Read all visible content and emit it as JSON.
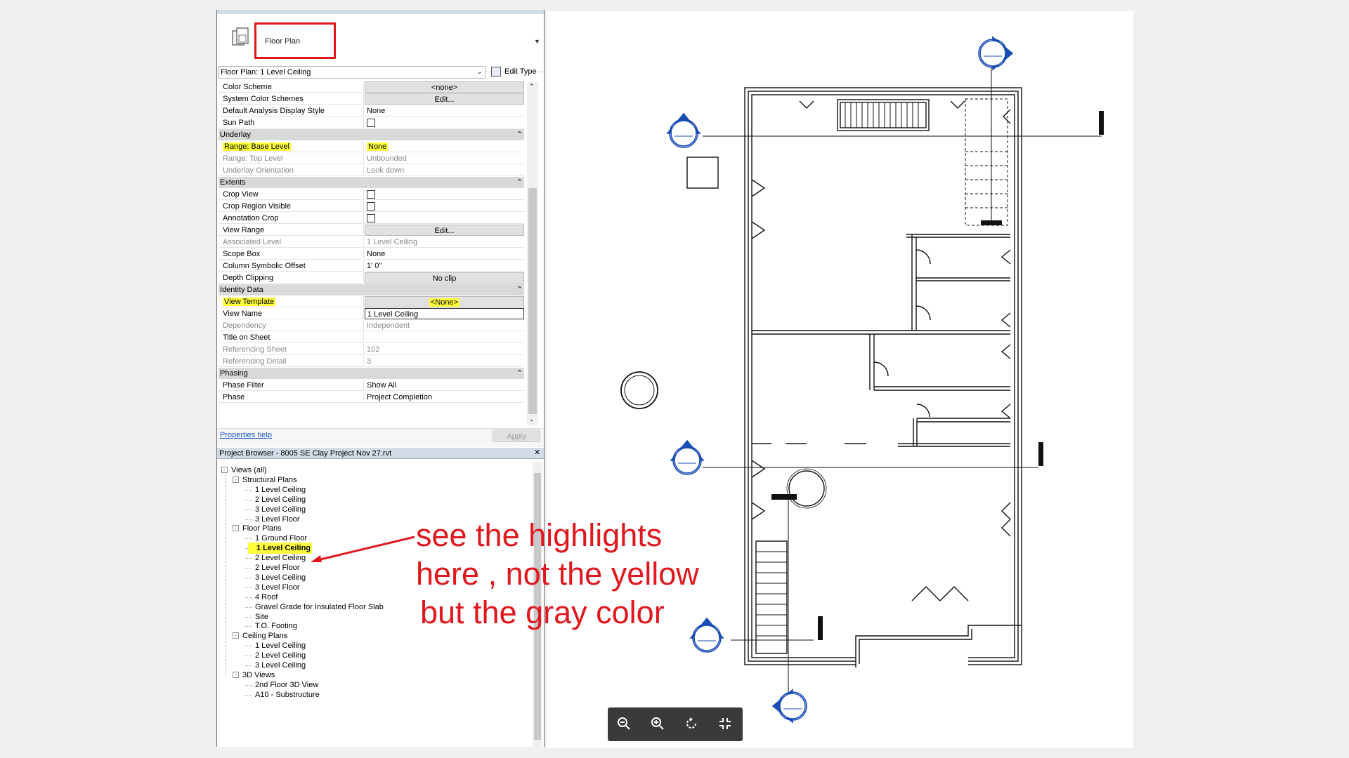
{
  "properties": {
    "type_name": "Floor Plan",
    "view_selector": "Floor Plan: 1 Level Ceiling",
    "edit_type_label": "Edit Type",
    "rows": [
      {
        "kind": "prop",
        "label": "Color Scheme",
        "value": "<none>",
        "style": "btn"
      },
      {
        "kind": "prop",
        "label": "System Color Schemes",
        "value": "Edit...",
        "style": "btn"
      },
      {
        "kind": "prop",
        "label": "Default Analysis Display Style",
        "value": "None"
      },
      {
        "kind": "prop",
        "label": "Sun Path",
        "value": "",
        "style": "check"
      },
      {
        "kind": "group",
        "label": "Underlay"
      },
      {
        "kind": "prop",
        "label": "Range: Base Level",
        "value": "None",
        "highlight": true
      },
      {
        "kind": "prop",
        "label": "Range: Top Level",
        "value": "Unbounded",
        "disabled": true
      },
      {
        "kind": "prop",
        "label": "Underlay Orientation",
        "value": "Look down",
        "disabled": true
      },
      {
        "kind": "group",
        "label": "Extents"
      },
      {
        "kind": "prop",
        "label": "Crop View",
        "value": "",
        "style": "check"
      },
      {
        "kind": "prop",
        "label": "Crop Region Visible",
        "value": "",
        "style": "check"
      },
      {
        "kind": "prop",
        "label": "Annotation Crop",
        "value": "",
        "style": "check"
      },
      {
        "kind": "prop",
        "label": "View Range",
        "value": "Edit...",
        "style": "btn"
      },
      {
        "kind": "prop",
        "label": "Associated Level",
        "value": "1 Level Ceiling",
        "disabled": true
      },
      {
        "kind": "prop",
        "label": "Scope Box",
        "value": "None"
      },
      {
        "kind": "prop",
        "label": "Column Symbolic Offset",
        "value": "1'  0\""
      },
      {
        "kind": "prop",
        "label": "Depth Clipping",
        "value": "No clip",
        "style": "btn"
      },
      {
        "kind": "group",
        "label": "Identity Data"
      },
      {
        "kind": "prop",
        "label": "View Template",
        "value": "<None>",
        "style": "btn",
        "highlight": true
      },
      {
        "kind": "prop",
        "label": "View Name",
        "value": "1 Level Ceiling",
        "style": "input"
      },
      {
        "kind": "prop",
        "label": "Dependency",
        "value": "Independent",
        "disabled": true
      },
      {
        "kind": "prop",
        "label": "Title on Sheet",
        "value": ""
      },
      {
        "kind": "prop",
        "label": "Referencing Sheet",
        "value": "102",
        "disabled": true
      },
      {
        "kind": "prop",
        "label": "Referencing Detail",
        "value": "3",
        "disabled": true
      },
      {
        "kind": "group",
        "label": "Phasing"
      },
      {
        "kind": "prop",
        "label": "Phase Filter",
        "value": "Show All"
      },
      {
        "kind": "prop",
        "label": "Phase",
        "value": "Project Completion"
      }
    ],
    "help_link": "Properties help",
    "apply_label": "Apply"
  },
  "project_browser": {
    "title": "Project Browser - 8005 SE Clay Project Nov 27.rvt",
    "tree": [
      {
        "level": 0,
        "label": "Views (all)",
        "toggle": "-"
      },
      {
        "level": 1,
        "label": "Structural Plans",
        "toggle": "-"
      },
      {
        "level": 2,
        "label": "1 Level Ceiling"
      },
      {
        "level": 2,
        "label": "2 Level Ceiling"
      },
      {
        "level": 2,
        "label": "3 Level Ceiling"
      },
      {
        "level": 2,
        "label": "3 Level Floor"
      },
      {
        "level": 1,
        "label": "Floor Plans",
        "toggle": "-"
      },
      {
        "level": 2,
        "label": "1 Ground Floor"
      },
      {
        "level": 2,
        "label": "1 Level Ceiling",
        "selected": true
      },
      {
        "level": 2,
        "label": "2 Level Ceiling"
      },
      {
        "level": 2,
        "label": "2 Level Floor"
      },
      {
        "level": 2,
        "label": "3 Level Ceiling"
      },
      {
        "level": 2,
        "label": "3 Level Floor"
      },
      {
        "level": 2,
        "label": "4 Roof"
      },
      {
        "level": 2,
        "label": "Gravel Grade for Insulated Floor Slab"
      },
      {
        "level": 2,
        "label": "Site"
      },
      {
        "level": 2,
        "label": "T.O. Footing"
      },
      {
        "level": 1,
        "label": "Ceiling Plans",
        "toggle": "-"
      },
      {
        "level": 2,
        "label": "1 Level Ceiling"
      },
      {
        "level": 2,
        "label": "2 Level Ceiling"
      },
      {
        "level": 2,
        "label": "3 Level Ceiling"
      },
      {
        "level": 1,
        "label": "3D Views",
        "toggle": "-"
      },
      {
        "level": 2,
        "label": "2nd Floor 3D View"
      },
      {
        "level": 2,
        "label": "A10 - Substructure"
      }
    ]
  },
  "annotation": {
    "lines": [
      "see the highlights",
      "here , not the yellow",
      "but the gray color"
    ],
    "color": "#e1171e"
  },
  "highlight_color": "#ffff3a",
  "viewer_toolbar": {
    "buttons": [
      {
        "name": "zoom-out-icon",
        "glyph": "⊖"
      },
      {
        "name": "zoom-in-icon",
        "glyph": "⊕"
      },
      {
        "name": "rotate-icon",
        "glyph": "↻"
      },
      {
        "name": "fit-screen-icon",
        "glyph": "⤡"
      }
    ]
  },
  "drawing": {
    "elevation_marker_text": "-"
  }
}
